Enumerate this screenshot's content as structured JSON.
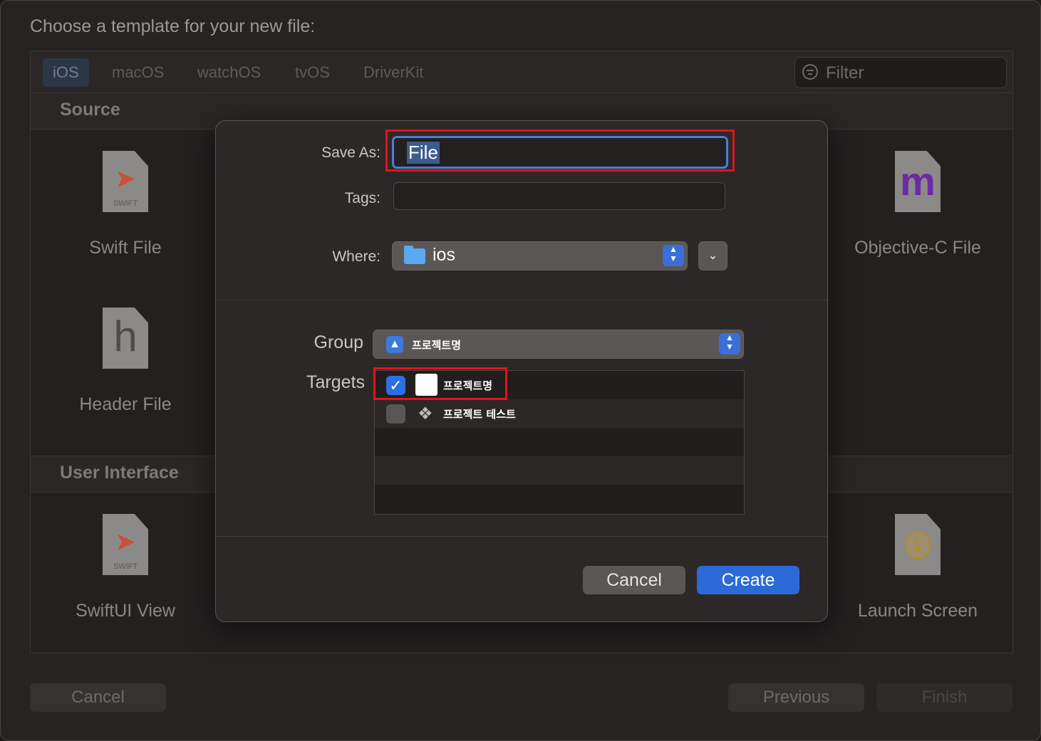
{
  "window": {
    "title": "Choose a template for your new file:"
  },
  "platform_tabs": [
    "iOS",
    "macOS",
    "watchOS",
    "tvOS",
    "DriverKit"
  ],
  "filter": {
    "placeholder": "Filter"
  },
  "sections": {
    "source": "Source",
    "user_interface": "User Interface"
  },
  "templates": {
    "swift_file": {
      "label": "Swift File",
      "icon": "swift-file-icon",
      "tag": "SWIFT"
    },
    "objc_file": {
      "label": "Objective-C File",
      "icon": "objc-file-icon",
      "glyph": "m"
    },
    "header_file": {
      "label": "Header File",
      "icon": "header-file-icon",
      "glyph": "h"
    },
    "swiftui_view": {
      "label": "SwiftUI View",
      "icon": "swift-file-icon",
      "tag": "SWIFT"
    },
    "launch_screen": {
      "label": "Launch Screen",
      "icon": "storyboard-icon",
      "glyph": "1"
    }
  },
  "bottom_buttons": {
    "cancel": "Cancel",
    "previous": "Previous",
    "finish": "Finish"
  },
  "sheet": {
    "save_as_label": "Save As:",
    "save_as_value": "File",
    "tags_label": "Tags:",
    "where_label": "Where:",
    "where_value": "ios",
    "group_label": "Group",
    "group_value": "프로젝트명",
    "targets_label": "Targets",
    "targets": [
      {
        "name": "프로젝트명",
        "checked": true
      },
      {
        "name": "프로젝트 테스트",
        "checked": false
      }
    ],
    "cancel": "Cancel",
    "create": "Create"
  },
  "colors": {
    "accent": "#2c6ad8",
    "highlight_box": "#e0141e",
    "sheet_bg": "#2c2827"
  }
}
